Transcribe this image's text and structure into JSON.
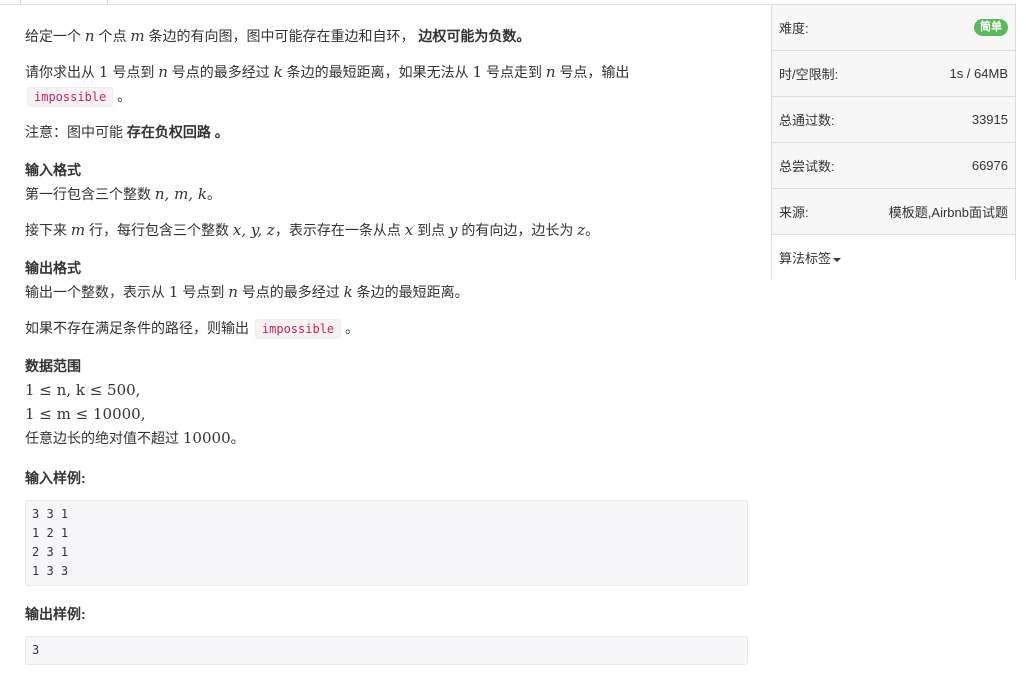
{
  "problem": {
    "intro": [
      "给定一个",
      "n",
      "个点",
      "m",
      "条边的有向图，图中可能存在重边和自环，",
      "边权可能为负数。"
    ],
    "ask": [
      "请你求出从",
      "1",
      "号点到",
      "n",
      "号点的最多经过",
      "k",
      "条边的最短距离，如果无法从",
      "1",
      "号点走到",
      "n",
      "号点，输出"
    ],
    "impossible": "impossible",
    "period": "。",
    "note": [
      "注意：图中可能",
      "存在负权回路",
      "。"
    ],
    "input_heading": "输入格式",
    "input_line1": [
      "第一行包含三个整数",
      "n, m, k",
      "。"
    ],
    "input_line2": [
      "接下来",
      "m",
      "行，每行包含三个整数",
      "x, y, z",
      "，表示存在一条从点",
      "x",
      "到点",
      "y",
      "的有向边，边长为",
      "z",
      "。"
    ],
    "output_heading": "输出格式",
    "output_line1": [
      "输出一个整数，表示从",
      "1",
      "号点到",
      "n",
      "号点的最多经过",
      "k",
      "条边的最短距离。"
    ],
    "output_line2": [
      "如果不存在满足条件的路径，则输出",
      "impossible",
      "。"
    ],
    "range_heading": "数据范围",
    "range1": "1 ≤ n, k ≤ 500,",
    "range2": "1 ≤ m ≤ 10000,",
    "range3": [
      "任意边长的绝对值不超过",
      "10000",
      "。"
    ],
    "sample_in_heading": "输入样例:",
    "sample_in": "3 3 1\n1 2 1\n2 3 1\n1 3 3",
    "sample_out_heading": "输出样例:",
    "sample_out": "3"
  },
  "sidebar": {
    "difficulty_label": "难度:",
    "difficulty_value": "简单",
    "limit_label": "时/空限制:",
    "limit_value": "1s / 64MB",
    "passed_label": "总通过数:",
    "passed_value": "33915",
    "tried_label": "总尝试数:",
    "tried_value": "66976",
    "source_label": "来源:",
    "source_value": "模板题,Airbnb面试题",
    "tags_label": "算法标签"
  },
  "colors": {
    "badge": "#5cb85c",
    "code_text": "#c7254e"
  }
}
